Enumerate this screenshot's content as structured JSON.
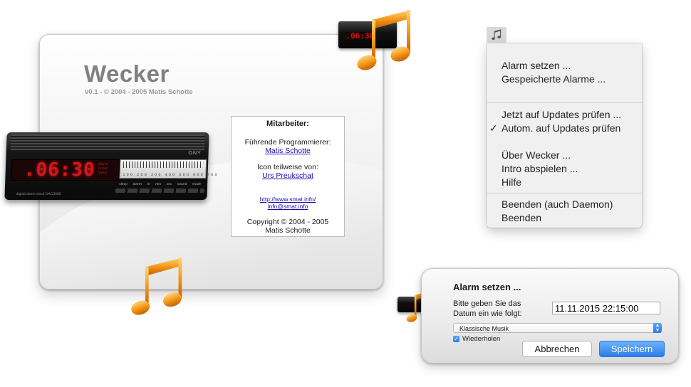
{
  "about": {
    "title": "Wecker",
    "version": "v0.1 - © 2004 - 2005 Matis Schotte",
    "credits": {
      "heading": "Mitarbeiter:",
      "programmer_label": "Führende Programmierer:",
      "programmer_name": "Matis Schotte",
      "icon_label": "Icon teilweise von:",
      "icon_name": "Urs Preukschat",
      "website": "http://www.smat.info/",
      "email": "info@smat.info",
      "copyright": "Copyright © 2004 - 2005",
      "copyright_name": "Matis Schotte"
    }
  },
  "clock": {
    "time": ".06:30",
    "brand": "ONY",
    "model": "digital alarm clock  DAC3300",
    "ampm": "Alarm\nPower\nSleep",
    "dial_numbers": "100 200 300 400 500 600 700",
    "buttons": "sleep alarm hr min sec sound mode"
  },
  "menu": {
    "items": [
      {
        "label": "Alarm setzen ..."
      },
      {
        "label": "Gespeicherte Alarme ..."
      },
      {
        "label": "Jetzt auf Updates prüfen ..."
      },
      {
        "label": "Autom. auf Updates prüfen",
        "checked": true
      },
      {
        "label": "Über Wecker ..."
      },
      {
        "label": "Intro abspielen ..."
      },
      {
        "label": "Hilfe"
      },
      {
        "label": "Beenden (auch Daemon)"
      },
      {
        "label": "Beenden"
      }
    ],
    "check_glyph": "✓"
  },
  "alarm_dialog": {
    "title": "Alarm setzen ...",
    "prompt_line1": "Bitte geben Sie das",
    "prompt_line2": "Datum ein wie folgt:",
    "date_value": "11.11.2015 22:15:00",
    "sound_selected": "Klassische Musik",
    "repeat_label": "Wiederholen",
    "repeat_checked": true,
    "cancel_label": "Abbrechen",
    "save_label": "Speichern"
  },
  "colors": {
    "accent_blue": "#2f7ae8",
    "led_red": "#d4161c",
    "note_orange": "#f39a1a"
  },
  "icons": [
    "music-note-icon",
    "alarm-clock-icon",
    "checkmark-icon",
    "chevron-up-down-icon"
  ]
}
